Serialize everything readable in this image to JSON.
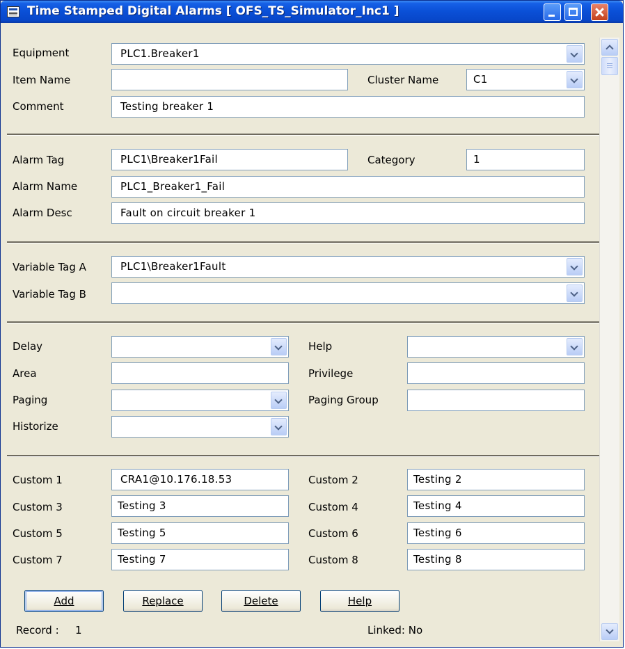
{
  "window": {
    "title": "Time Stamped Digital Alarms [ OFS_TS_Simulator_Inc1 ]"
  },
  "general": {
    "equipment_label": "Equipment",
    "equipment_value": "PLC1.Breaker1",
    "item_name_label": "Item Name",
    "item_name_value": "",
    "cluster_name_label": "Cluster Name",
    "cluster_name_value": "C1",
    "comment_label": "Comment",
    "comment_value": "Testing breaker 1"
  },
  "alarm": {
    "tag_label": "Alarm Tag",
    "tag_value": "PLC1\\Breaker1Fail",
    "category_label": "Category",
    "category_value": "1",
    "name_label": "Alarm Name",
    "name_value": "PLC1_Breaker1_Fail",
    "desc_label": "Alarm Desc",
    "desc_value": "Fault on circuit breaker 1"
  },
  "variables": {
    "tag_a_label": "Variable Tag A",
    "tag_a_value": "PLC1\\Breaker1Fault",
    "tag_b_label": "Variable Tag B",
    "tag_b_value": ""
  },
  "options": {
    "delay_label": "Delay",
    "delay_value": "",
    "help_label": "Help",
    "help_value": "",
    "area_label": "Area",
    "area_value": "",
    "privilege_label": "Privilege",
    "privilege_value": "",
    "paging_label": "Paging",
    "paging_value": "",
    "paging_group_label": "Paging Group",
    "paging_group_value": "",
    "historize_label": "Historize",
    "historize_value": ""
  },
  "custom": [
    {
      "label": "Custom 1",
      "value": "CRA1@10.176.18.53"
    },
    {
      "label": "Custom 2",
      "value": "Testing 2"
    },
    {
      "label": "Custom 3",
      "value": "Testing 3"
    },
    {
      "label": "Custom 4",
      "value": "Testing 4"
    },
    {
      "label": "Custom 5",
      "value": "Testing 5"
    },
    {
      "label": "Custom 6",
      "value": "Testing 6"
    },
    {
      "label": "Custom 7",
      "value": "Testing 7"
    },
    {
      "label": "Custom 8",
      "value": "Testing 8"
    }
  ],
  "buttons": {
    "add": "Add",
    "replace": "Replace",
    "delete": "Delete",
    "help": "Help"
  },
  "status": {
    "record_label": "Record :",
    "record_value": "1",
    "linked": "Linked: No"
  },
  "icons": {
    "app": "app-window-icon",
    "minimize": "minimize-icon",
    "maximize": "maximize-icon",
    "close": "close-icon",
    "dropdown": "chevron-down-icon",
    "scroll_up": "scroll-up-arrow-icon",
    "scroll_down": "scroll-down-arrow-icon"
  },
  "colors": {
    "titlebar": "#0a4fd6",
    "dialog_background": "#ece9d8",
    "field_border": "#7f9db9"
  }
}
